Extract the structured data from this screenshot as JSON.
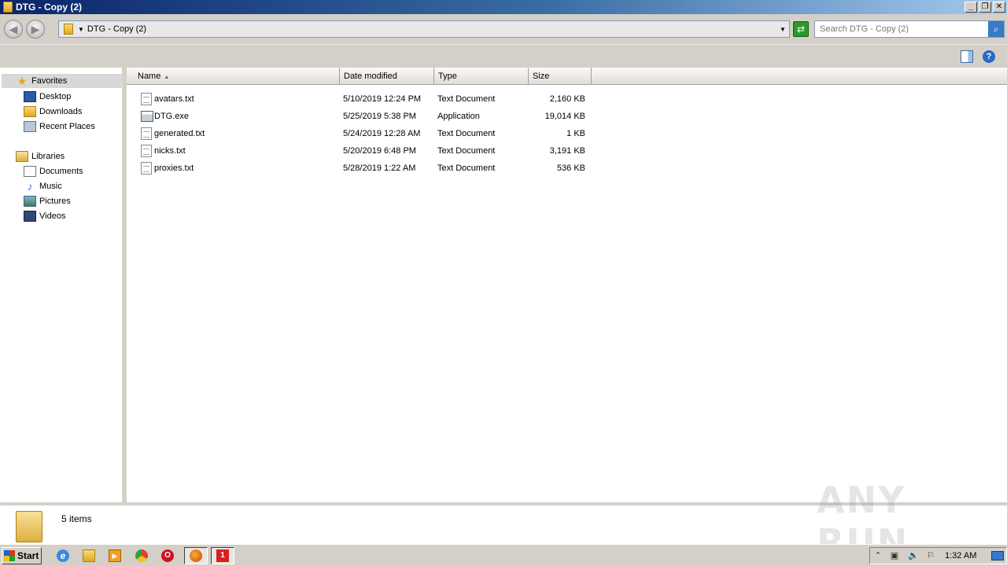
{
  "window": {
    "title": "DTG - Copy (2)",
    "minimize": "_",
    "restore": "❐",
    "close": "✕"
  },
  "address": {
    "breadcrumb": "DTG - Copy (2)",
    "search_placeholder": "Search DTG - Copy (2)"
  },
  "nav": {
    "favorites": {
      "label": "Favorites",
      "items": [
        "Desktop",
        "Downloads",
        "Recent Places"
      ]
    },
    "libraries": {
      "label": "Libraries",
      "items": [
        "Documents",
        "Music",
        "Pictures",
        "Videos"
      ]
    }
  },
  "columns": {
    "name": "Name",
    "date": "Date modified",
    "type": "Type",
    "size": "Size"
  },
  "files": [
    {
      "name": "avatars.txt",
      "date": "5/10/2019 12:24 PM",
      "type": "Text Document",
      "size": "2,160 KB",
      "icon": "text-file-icon"
    },
    {
      "name": "DTG.exe",
      "date": "5/25/2019 5:38 PM",
      "type": "Application",
      "size": "19,014 KB",
      "icon": "exe-file-icon"
    },
    {
      "name": "generated.txt",
      "date": "5/24/2019 12:28 AM",
      "type": "Text Document",
      "size": "1 KB",
      "icon": "text-file-icon"
    },
    {
      "name": "nicks.txt",
      "date": "5/20/2019 6:48 PM",
      "type": "Text Document",
      "size": "3,191 KB",
      "icon": "text-file-icon"
    },
    {
      "name": "proxies.txt",
      "date": "5/28/2019 1:22 AM",
      "type": "Text Document",
      "size": "536 KB",
      "icon": "text-file-icon"
    }
  ],
  "details": {
    "item_count": "5 items"
  },
  "watermark": "ANY RUN",
  "taskbar": {
    "start_label": "Start",
    "clock": "1:32 AM",
    "alert_badge": "1"
  }
}
